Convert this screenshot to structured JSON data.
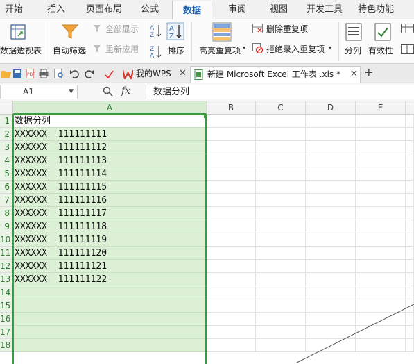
{
  "menu": {
    "tabs": [
      "开始",
      "插入",
      "页面布局",
      "公式",
      "数据",
      "审阅",
      "视图",
      "开发工具",
      "特色功能"
    ],
    "active": "数据"
  },
  "ribbon": {
    "pivot": "数据透视表",
    "autofilter": "自动筛选",
    "show_all": "全部显示",
    "reapply": "重新应用",
    "sort": "排序",
    "highlight_dup": "高亮重复项",
    "remove_dup": "删除重复项",
    "reject_dup": "拒绝录入重复项",
    "split": "分列",
    "validity": "有效性"
  },
  "doc_tabs": [
    {
      "label": "我的WPS",
      "icon": "wps-logo-icon"
    },
    {
      "label": "新建 Microsoft Excel 工作表 .xls *",
      "icon": "excel-file-icon"
    }
  ],
  "formula_bar": {
    "cell_ref": "A1",
    "fx": "fx",
    "content": "数据分列"
  },
  "grid": {
    "columns": [
      "A",
      "B",
      "C",
      "D",
      "E"
    ],
    "selected_column": "A",
    "row_numbers": [
      "1",
      "2",
      "3",
      "4",
      "5",
      "6",
      "7",
      "8",
      "9",
      "10",
      "11",
      "12",
      "13",
      "14",
      "15",
      "16",
      "17",
      "18"
    ],
    "cells_A": [
      "数据分列",
      "XXXXXX  111111111",
      "XXXXXX  111111112",
      "XXXXXX  111111113",
      "XXXXXX  111111114",
      "XXXXXX  111111115",
      "XXXXXX  111111116",
      "XXXXXX  111111117",
      "XXXXXX  111111118",
      "XXXXXX  111111119",
      "XXXXXX  111111120",
      "XXXXXX  111111121",
      "XXXXXX  111111122",
      "",
      "",
      "",
      "",
      ""
    ]
  },
  "colors": {
    "accent_green": "#3d9a40",
    "selection_fill": "#dbf0d5",
    "active_tab_text": "#1b5fae"
  }
}
